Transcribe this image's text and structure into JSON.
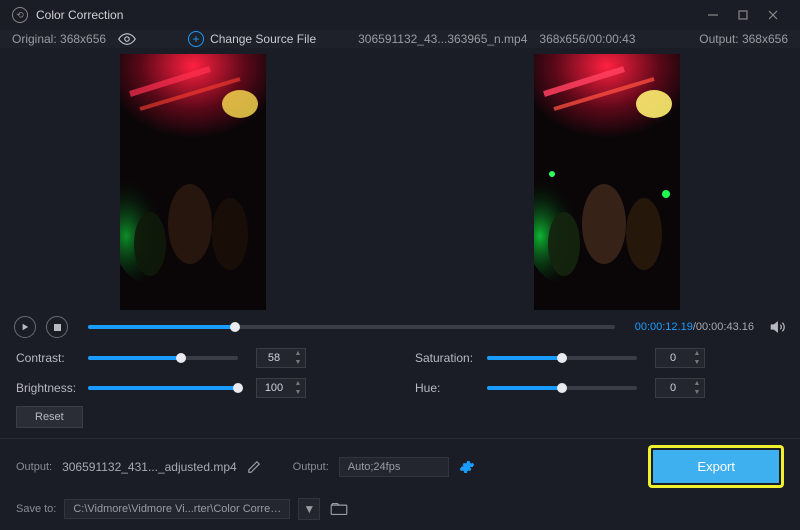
{
  "window": {
    "title": "Color Correction"
  },
  "topbar": {
    "original_label": "Original: 368x656",
    "change_source": "Change Source File",
    "filename": "306591132_43...363965_n.mp4",
    "dims_duration": "368x656/00:00:43",
    "output_label": "Output: 368x656"
  },
  "transport": {
    "current_time": "00:00:12.19",
    "total_time": "/00:00:43.16",
    "progress_pct": 28
  },
  "sliders": {
    "contrast": {
      "label": "Contrast:",
      "value": "58",
      "pct": 62
    },
    "saturation": {
      "label": "Saturation:",
      "value": "0",
      "pct": 50
    },
    "brightness": {
      "label": "Brightness:",
      "value": "100",
      "pct": 100
    },
    "hue": {
      "label": "Hue:",
      "value": "0",
      "pct": 50
    }
  },
  "reset": {
    "label": "Reset"
  },
  "output": {
    "label": "Output:",
    "filename": "306591132_431..._adjusted.mp4",
    "settings_label": "Output:",
    "settings_value": "Auto;24fps"
  },
  "save": {
    "label": "Save to:",
    "path": "C:\\Vidmore\\Vidmore Vi...rter\\Color Correction"
  },
  "export": {
    "label": "Export"
  }
}
